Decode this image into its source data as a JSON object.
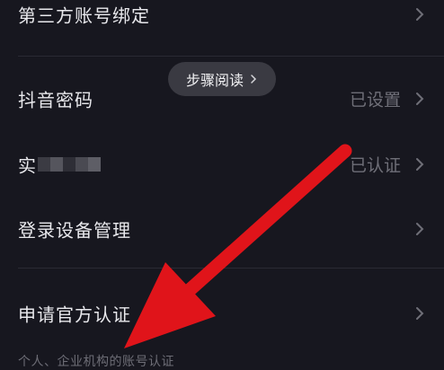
{
  "settings": {
    "rows": [
      {
        "label": "第三方账号绑定",
        "value": ""
      },
      {
        "label": "抖音密码",
        "value": "已设置"
      },
      {
        "label": "实",
        "value": "已认证"
      },
      {
        "label": "登录设备管理",
        "value": ""
      },
      {
        "label": "申请官方认证",
        "value": ""
      }
    ],
    "official_hint": "个人、企业机构的账号认证"
  },
  "toast": {
    "label": "步骤阅读",
    "icon": "chevron-right-icon"
  },
  "annotation": {
    "arrow_color": "#e0141a"
  },
  "icons": {
    "row_chevron": "chevron-right-icon"
  },
  "colors": {
    "background": "#17171f",
    "text": "#e8e8ec",
    "muted": "#6f6f78",
    "toast_bg": "#3a3a42"
  }
}
